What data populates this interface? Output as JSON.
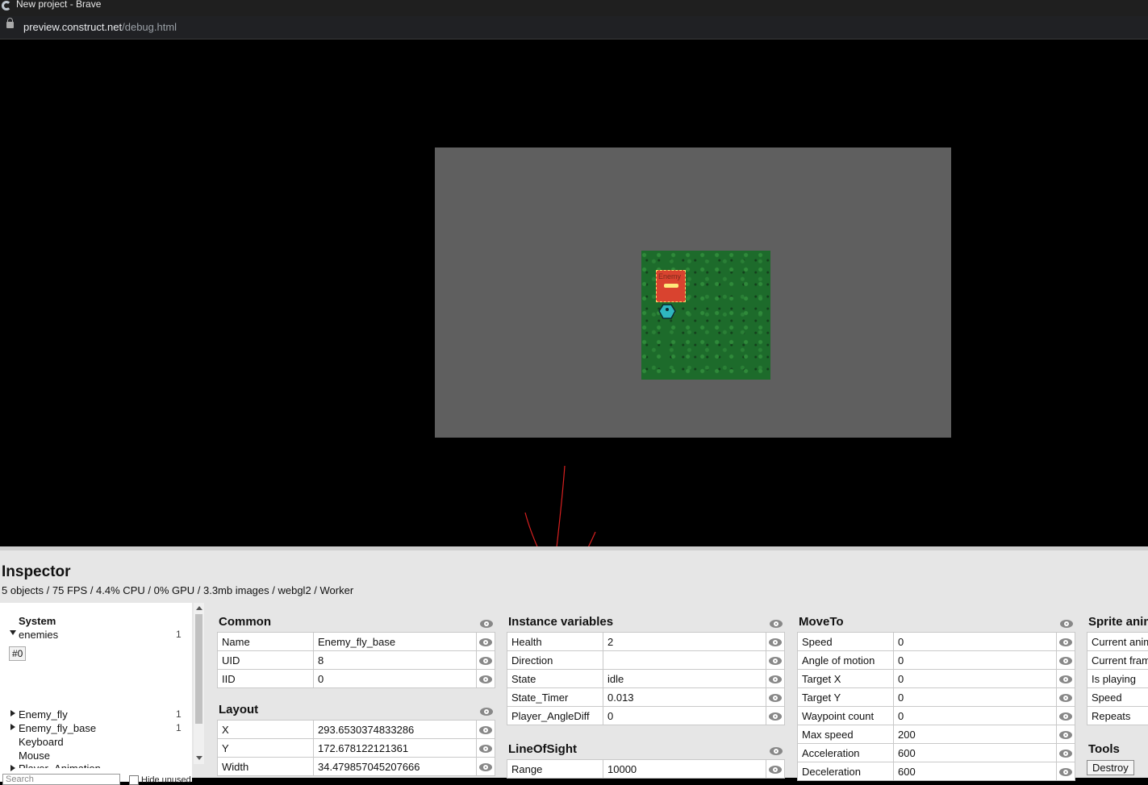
{
  "browser": {
    "window_title": "New project - Brave",
    "url_host": "preview.construct.net",
    "url_path": "/debug.html"
  },
  "game": {
    "enemy_label": "Enemy"
  },
  "inspector": {
    "title": "Inspector",
    "status": "5 objects / 75 FPS / 4.4% CPU / 0% GPU / 3.3mb images / webgl2 / Worker",
    "tree": {
      "system": "System",
      "enemies": {
        "label": "enemies",
        "count": "1"
      },
      "instance": "#0",
      "enemy_fly": {
        "label": "Enemy_fly",
        "count": "1"
      },
      "enemy_fly_base": {
        "label": "Enemy_fly_base",
        "count": "1"
      },
      "keyboard": "Keyboard",
      "mouse": "Mouse",
      "player_animation": "Player_Animation"
    },
    "search_placeholder": "Search",
    "hide_unused_label": "Hide unused",
    "common": {
      "title": "Common",
      "rows": [
        {
          "key": "Name",
          "value": "Enemy_fly_base"
        },
        {
          "key": "UID",
          "value": "8"
        },
        {
          "key": "IID",
          "value": "0"
        }
      ]
    },
    "layout": {
      "title": "Layout",
      "rows": [
        {
          "key": "X",
          "value": "293.6530374833286"
        },
        {
          "key": "Y",
          "value": "172.678122121361"
        },
        {
          "key": "Width",
          "value": "34.479857045207666"
        }
      ]
    },
    "instance_variables": {
      "title": "Instance variables",
      "rows": [
        {
          "key": "Health",
          "value": "2"
        },
        {
          "key": "Direction",
          "value": ""
        },
        {
          "key": "State",
          "value": "idle"
        },
        {
          "key": "State_Timer",
          "value": "0.013"
        },
        {
          "key": "Player_AngleDiff",
          "value": "0"
        }
      ]
    },
    "line_of_sight": {
      "title": "LineOfSight",
      "rows": [
        {
          "key": "Range",
          "value": "10000"
        }
      ]
    },
    "move_to": {
      "title": "MoveTo",
      "rows": [
        {
          "key": "Speed",
          "value": "0"
        },
        {
          "key": "Angle of motion",
          "value": "0"
        },
        {
          "key": "Target X",
          "value": "0"
        },
        {
          "key": "Target Y",
          "value": "0"
        },
        {
          "key": "Waypoint count",
          "value": "0"
        },
        {
          "key": "Max speed",
          "value": "200"
        },
        {
          "key": "Acceleration",
          "value": "600"
        },
        {
          "key": "Deceleration",
          "value": "600"
        }
      ]
    },
    "sprite_anim": {
      "title": "Sprite animation",
      "rows": [
        {
          "key": "Current animation"
        },
        {
          "key": "Current frame"
        },
        {
          "key": "Is playing"
        },
        {
          "key": "Speed"
        },
        {
          "key": "Repeats"
        }
      ]
    },
    "tools": {
      "title": "Tools",
      "destroy": "Destroy"
    }
  }
}
